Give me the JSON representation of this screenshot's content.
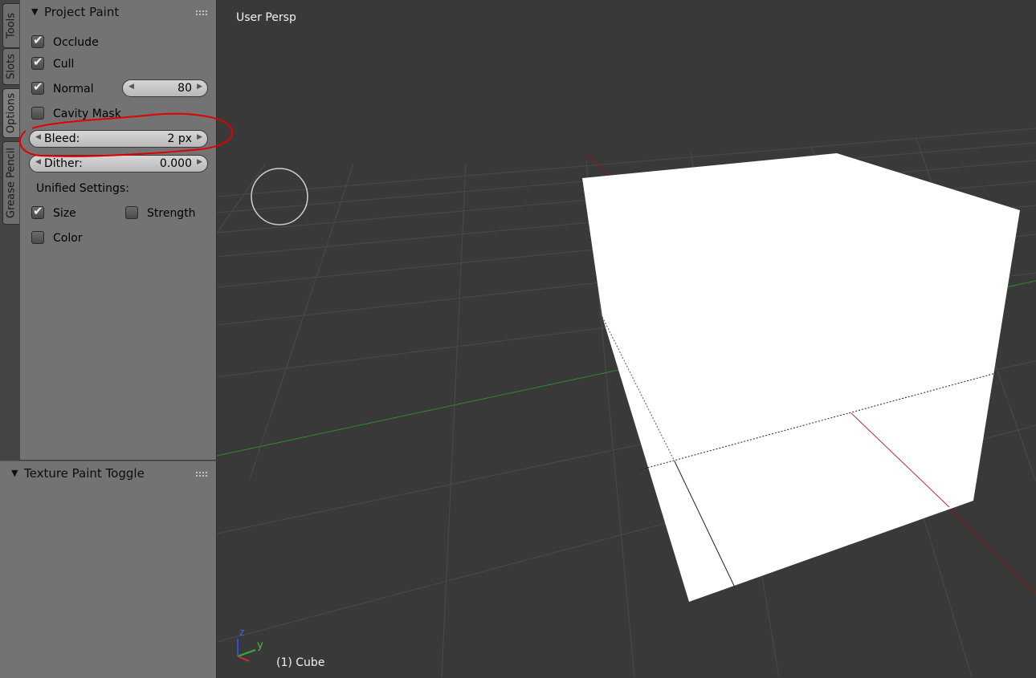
{
  "tabs": [
    "Tools",
    "Slots",
    "Options",
    "Grease Pencil"
  ],
  "project_paint": {
    "title": "Project Paint",
    "occlude": {
      "label": "Occlude",
      "checked": true
    },
    "cull": {
      "label": "Cull",
      "checked": true
    },
    "normal": {
      "label": "Normal",
      "checked": true,
      "value": "80"
    },
    "cavity_mask": {
      "label": "Cavity Mask",
      "checked": false
    },
    "bleed": {
      "label": "Bleed:",
      "value": "2 px"
    },
    "dither": {
      "label": "Dither:",
      "value": "0.000"
    },
    "unified_settings": {
      "label": "Unified Settings:",
      "size": {
        "label": "Size",
        "checked": true
      },
      "strength": {
        "label": "Strength",
        "checked": false
      },
      "color": {
        "label": "Color",
        "checked": false
      }
    }
  },
  "texture_paint_toggle": {
    "title": "Texture Paint Toggle"
  },
  "viewport": {
    "view_name": "User Persp",
    "object_label": "(1) Cube",
    "axis_labels": {
      "z": "z",
      "y": "y"
    }
  },
  "colors": {
    "viewport_bg": "#393939",
    "panel_bg": "#737373",
    "annotation": "#e00000",
    "axis_x": "#8b1a1a",
    "axis_y": "#2e8b2e"
  }
}
